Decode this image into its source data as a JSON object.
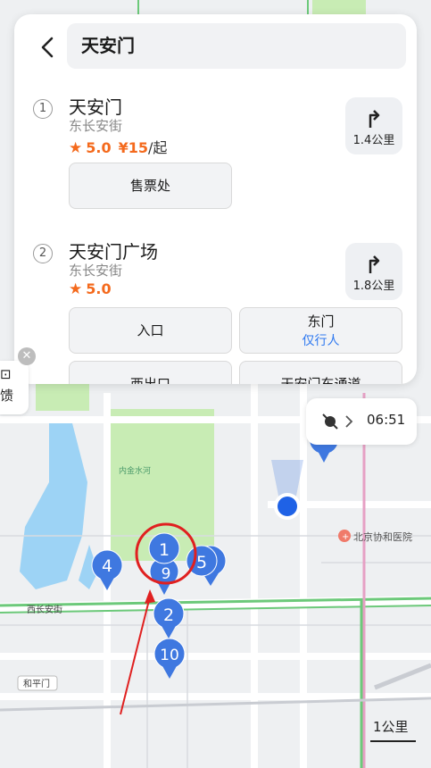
{
  "search": {
    "query": "天安门"
  },
  "results": [
    {
      "index": "1",
      "name": "天安门",
      "address": "东长安街",
      "rating": "5.0",
      "price": "¥15",
      "price_unit": "/起",
      "distance": "1.4公里",
      "buttons": [
        {
          "label": "售票处",
          "sub": ""
        }
      ]
    },
    {
      "index": "2",
      "name": "天安门广场",
      "address": "东长安街",
      "rating": "5.0",
      "distance": "1.8公里",
      "buttons": [
        {
          "label": "入口",
          "sub": ""
        },
        {
          "label": "东门",
          "sub": "仅行人"
        },
        {
          "label": "西出口",
          "sub": ""
        },
        {
          "label": "天安门东通道",
          "sub": ""
        }
      ]
    }
  ],
  "map": {
    "time": "06:51",
    "poi_hospital": "北京协和医院",
    "road_west_changan": "西长安街",
    "road_heping": "和平门",
    "park_label": "内金水河",
    "side_chip_text": "馈",
    "scale_label": "1公里",
    "markers": [
      "1",
      "9",
      "5",
      "4",
      "2",
      "10",
      "6"
    ]
  },
  "colors": {
    "marker": "#3f78e0",
    "accent": "#2e78f0",
    "rating": "#f46a1d",
    "annotation": "#e02020"
  }
}
